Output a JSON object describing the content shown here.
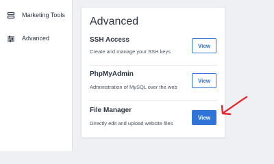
{
  "sidebar": {
    "items": [
      {
        "label": "Marketing Tools",
        "icon": "stack-icon"
      },
      {
        "label": "Advanced",
        "icon": "sliders-icon"
      }
    ]
  },
  "panel": {
    "title": "Advanced",
    "sections": [
      {
        "title": "SSH Access",
        "description": "Create and manage your SSH keys",
        "button": "View"
      },
      {
        "title": "PhpMyAdmin",
        "description": "Administration of MySQL over the web",
        "button": "View"
      },
      {
        "title": "File Manager",
        "description": "Directly edit and upload website files",
        "button": "View"
      }
    ]
  },
  "colors": {
    "accent": "#2f74d6",
    "annotation": "#e8262b",
    "background": "#eef0f4"
  }
}
